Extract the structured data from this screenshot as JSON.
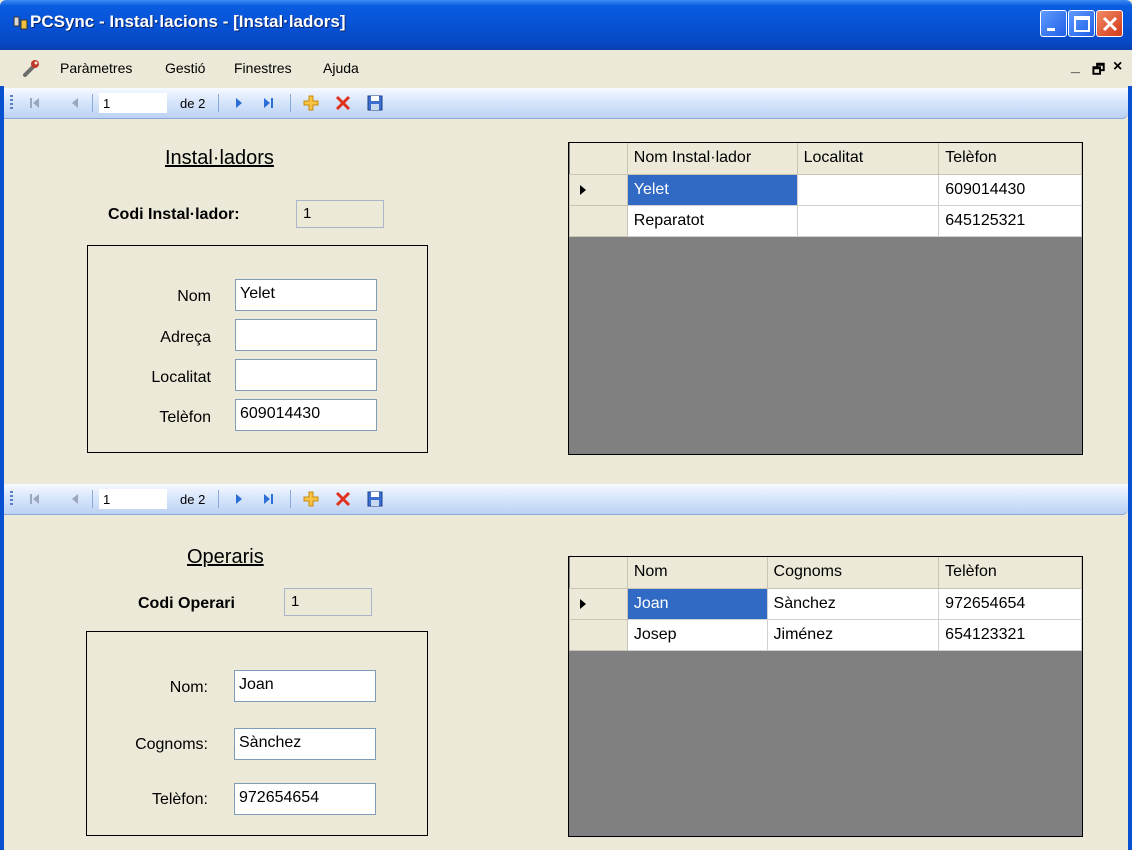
{
  "window": {
    "title": "PCSync - Instal·lacions - [Instal·ladors]",
    "controls": [
      "minimize",
      "maximize",
      "close"
    ]
  },
  "menu": {
    "items": [
      "Paràmetres",
      "Gestió",
      "Finestres",
      "Ajuda"
    ],
    "mdi_controls": [
      "_",
      "🗗",
      "×"
    ]
  },
  "nav_top": {
    "position": "1",
    "count_label": "de 2"
  },
  "nav_bottom": {
    "position": "1",
    "count_label": "de 2"
  },
  "installers": {
    "title": "Instal·ladors",
    "code_label": "Codi Instal·lador:",
    "code_value": "1",
    "fields": [
      {
        "label": "Nom",
        "value": "Yelet"
      },
      {
        "label": "Adreça",
        "value": ""
      },
      {
        "label": "Localitat",
        "value": ""
      },
      {
        "label": "Telèfon",
        "value": "609014430"
      }
    ],
    "grid": {
      "columns": [
        "Nom Instal·lador",
        "Localitat",
        "Telèfon"
      ],
      "rows": [
        [
          "Yelet",
          "",
          "609014430"
        ],
        [
          "Reparatot",
          "",
          "645125321"
        ]
      ],
      "selected_row": 0
    }
  },
  "operators": {
    "title": "Operaris",
    "code_label": "Codi Operari",
    "code_value": "1",
    "fields": [
      {
        "label": "Nom:",
        "value": "Joan"
      },
      {
        "label": "Cognoms:",
        "value": "Sànchez"
      },
      {
        "label": "Telèfon:",
        "value": "972654654"
      }
    ],
    "grid": {
      "columns": [
        "Nom",
        "Cognoms",
        "Telèfon"
      ],
      "rows": [
        [
          "Joan",
          "Sànchez",
          "972654654"
        ],
        [
          "Josep",
          "Jiménez",
          "654123321"
        ]
      ],
      "selected_row": 0
    }
  }
}
